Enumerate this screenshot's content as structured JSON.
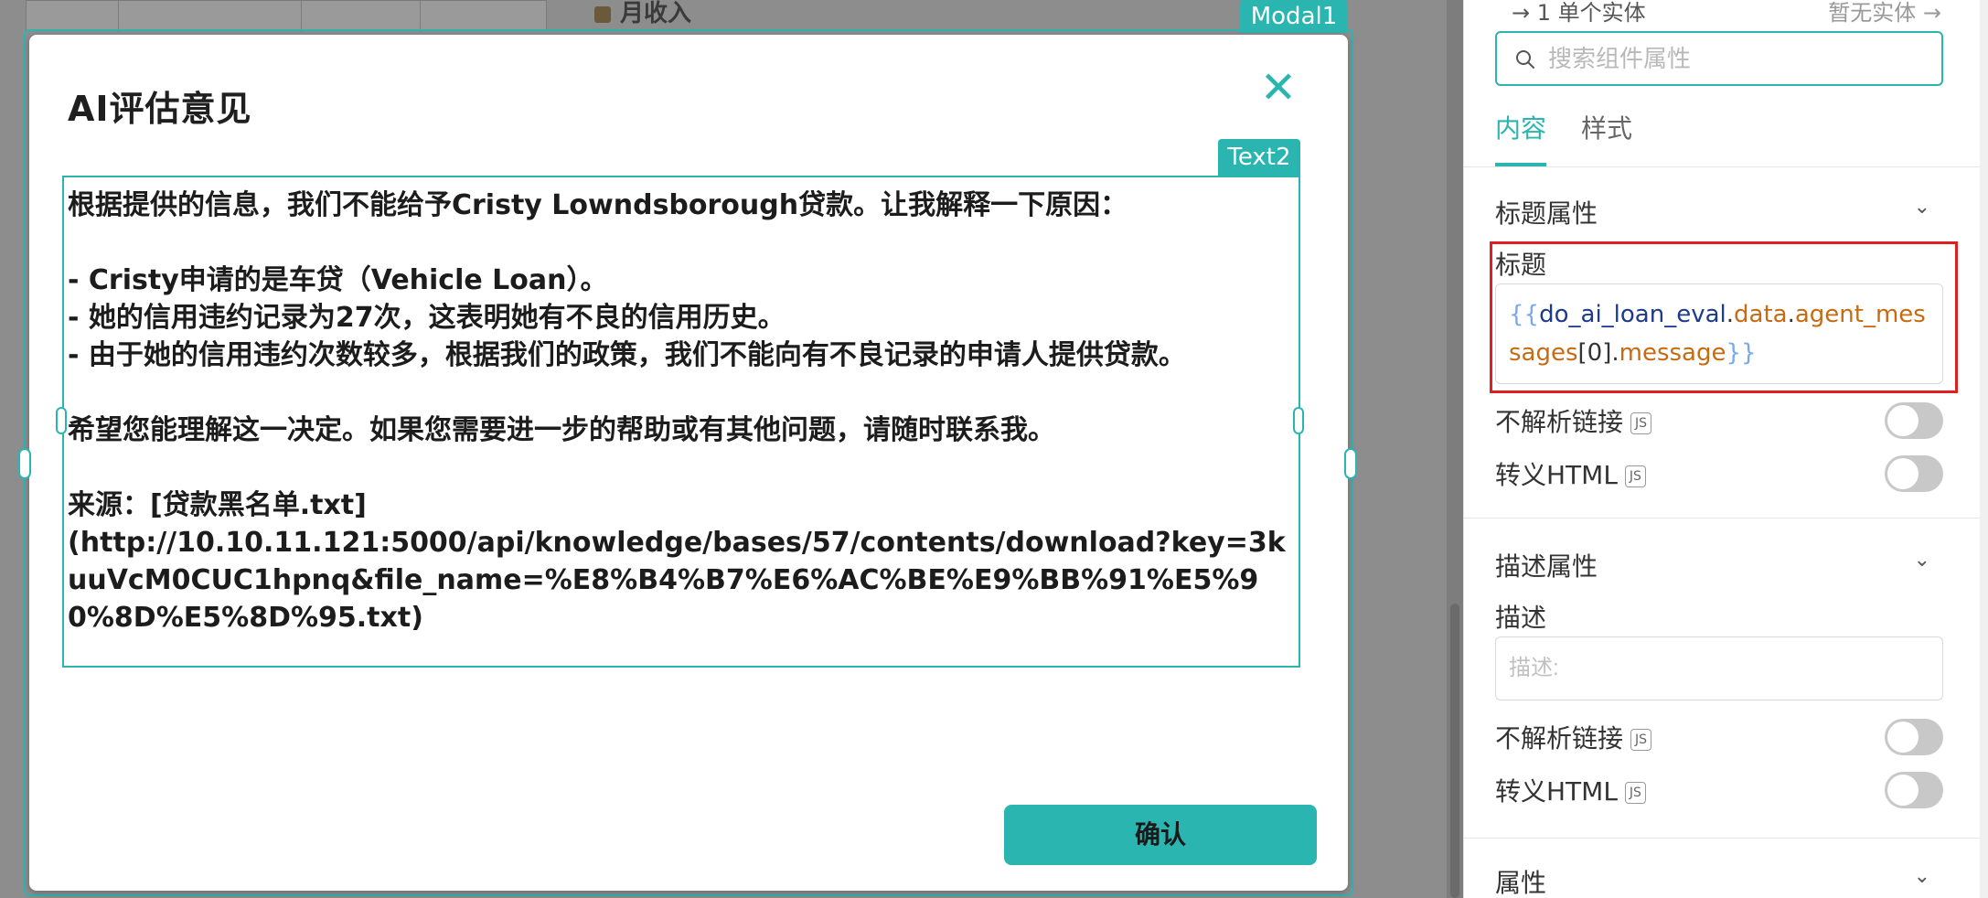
{
  "background": {
    "label": "月收入"
  },
  "modal": {
    "tag": "Modal1",
    "title": "AI评估意见",
    "close_icon": "close-icon",
    "text_component_tag": "Text2",
    "message_lines": [
      "根据提供的信息，我们不能给予Cristy Lowndsborough贷款。让我解释一下原因：",
      "",
      "- Cristy申请的是车贷（Vehicle Loan）。",
      "- 她的信用违约记录为27次，这表明她有不良的信用历史。",
      "- 由于她的信用违约次数较多，根据我们的政策，我们不能向有不良记录的申请人提供贷款。",
      "",
      "希望您能理解这一决定。如果您需要进一步的帮助或有其他问题，请随时联系我。",
      "",
      "来源：[贷款黑名单.txt]",
      "(http://10.10.11.121:5000/api/knowledge/bases/57/contents/download?key=3kuuVcM0CUC1hpnq&file_name=%E8%B4%B7%E6%AC%BE%E9%BB%91%E5%90%8D%E5%8D%95.txt)"
    ],
    "confirm_label": "确认"
  },
  "panel": {
    "nav_left": "→ 1 单个实体",
    "nav_right": "暂无实体 →",
    "search_placeholder": "搜索组件属性",
    "tabs": [
      {
        "label": "内容",
        "active": true
      },
      {
        "label": "样式",
        "active": false
      }
    ],
    "title_section": {
      "header": "标题属性",
      "field_label": "标题",
      "expression": {
        "open": "{{",
        "var": "do_ai_loan_eval",
        "dot1": ".",
        "prop1": "data",
        "dot2": ".",
        "prop2": "agent_messages",
        "index": "[0]",
        "dot3": ".",
        "prop3": "message",
        "close": "}}"
      },
      "toggles": [
        {
          "label": "不解析链接",
          "js": "JS",
          "on": false
        },
        {
          "label": "转义HTML",
          "js": "JS",
          "on": false
        }
      ]
    },
    "desc_section": {
      "header": "描述属性",
      "field_label": "描述",
      "placeholder": "描述:",
      "toggles": [
        {
          "label": "不解析链接",
          "js": "JS",
          "on": false
        },
        {
          "label": "转义HTML",
          "js": "JS",
          "on": false
        }
      ]
    },
    "attr_section": {
      "header": "属性"
    },
    "colors": {
      "accent": "#2bb5b1",
      "highlight": "#e02020"
    }
  }
}
